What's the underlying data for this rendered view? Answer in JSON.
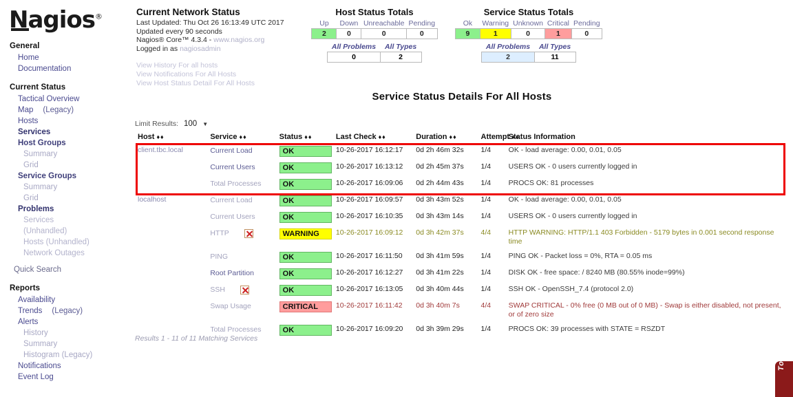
{
  "brand": {
    "name": "Nagios",
    "registered": "®"
  },
  "sidebar": {
    "sections": [
      {
        "title": "General",
        "items": [
          {
            "label": "Home",
            "style": "link"
          },
          {
            "label": "Documentation",
            "style": "link"
          }
        ]
      },
      {
        "title": "Current Status",
        "items": [
          {
            "label": "Tactical Overview",
            "style": "link"
          },
          {
            "label": "Map",
            "suffix": "(Legacy)",
            "style": "link"
          },
          {
            "label": "Hosts",
            "style": "link"
          },
          {
            "label": "Services",
            "style": "bold"
          },
          {
            "label": "Host Groups",
            "style": "semi"
          },
          {
            "label": "Summary",
            "style": "faded"
          },
          {
            "label": "Grid",
            "style": "faded"
          },
          {
            "label": "Service Groups",
            "style": "semi"
          },
          {
            "label": "Summary",
            "style": "faded"
          },
          {
            "label": "Grid",
            "style": "faded"
          },
          {
            "label": "Problems",
            "style": "bold"
          },
          {
            "label": "Services",
            "style": "faded2"
          },
          {
            "label": "(Unhandled)",
            "style": "faded2"
          },
          {
            "label": "Hosts (Unhandled)",
            "style": "faded2"
          },
          {
            "label": "Network Outages",
            "style": "faded2"
          }
        ]
      }
    ],
    "quick_search": "Quick Search",
    "reports": {
      "title": "Reports",
      "items": [
        {
          "label": "Availability",
          "style": "link"
        },
        {
          "label": "Trends",
          "suffix": "(Legacy)",
          "style": "link"
        },
        {
          "label": "Alerts",
          "style": "link"
        },
        {
          "label": "History",
          "style": "faded"
        },
        {
          "label": "Summary",
          "style": "faded"
        },
        {
          "label": "Histogram (Legacy)",
          "style": "faded"
        },
        {
          "label": "Notifications",
          "style": "link"
        },
        {
          "label": "Event Log",
          "style": "link"
        }
      ]
    }
  },
  "network_status": {
    "title": "Current Network Status",
    "last_updated": "Last Updated: Thu Oct 26 16:13:49 UTC 2017",
    "update_interval": "Updated every 90 seconds",
    "version": "Nagios® Core™ 4.3.4 - ",
    "version_url": "www.nagios.org",
    "logged_in_prefix": "Logged in as ",
    "logged_in_user": "nagiosadmin",
    "links": [
      "View History For all hosts",
      "View Notifications For All Hosts",
      "View Host Status Detail For All Hosts"
    ]
  },
  "host_totals": {
    "title": "Host Status Totals",
    "headers": [
      "Up",
      "Down",
      "Unreachable",
      "Pending"
    ],
    "values": [
      "2",
      "0",
      "0",
      "0"
    ],
    "summary_headers": [
      "All Problems",
      "All Types"
    ],
    "summary_values": [
      "0",
      "2"
    ]
  },
  "service_totals": {
    "title": "Service Status Totals",
    "headers": [
      "Ok",
      "Warning",
      "Unknown",
      "Critical",
      "Pending"
    ],
    "values": [
      "9",
      "1",
      "0",
      "1",
      "0"
    ],
    "summary_headers": [
      "All Problems",
      "All Types"
    ],
    "summary_values": [
      "2",
      "11"
    ]
  },
  "main": {
    "title": "Service Status Details For All Hosts",
    "limit_label": "Limit Results:",
    "limit_value": "100",
    "results_footer": "Results 1 - 11 of 11 Matching Services",
    "columns": [
      "Host",
      "Service",
      "Status",
      "Last Check",
      "Duration",
      "Attempt",
      "Status Information"
    ],
    "rows": [
      {
        "host": "client.tbc.local",
        "service": "Current Load",
        "service_muted": false,
        "no_notify": false,
        "status": "OK",
        "status_class": "ok",
        "last_check": "10-26-2017 16:12:17",
        "duration": "0d 2h 46m 32s",
        "attempt": "1/4",
        "info": "OK - load average: 0.00, 0.01, 0.05"
      },
      {
        "host": "",
        "service": "Current Users",
        "service_muted": false,
        "no_notify": false,
        "status": "OK",
        "status_class": "ok",
        "last_check": "10-26-2017 16:13:12",
        "duration": "0d 2h 45m 37s",
        "attempt": "1/4",
        "info": "USERS OK - 0 users currently logged in"
      },
      {
        "host": "",
        "service": "Total Processes",
        "service_muted": true,
        "no_notify": false,
        "status": "OK",
        "status_class": "ok",
        "last_check": "10-26-2017 16:09:06",
        "duration": "0d 2h 44m 43s",
        "attempt": "1/4",
        "info": "PROCS OK: 81 processes"
      },
      {
        "host": "localhost",
        "service": "Current Load",
        "service_muted": true,
        "no_notify": false,
        "status": "OK",
        "status_class": "ok",
        "last_check": "10-26-2017 16:09:57",
        "duration": "0d 3h 43m 52s",
        "attempt": "1/4",
        "info": "OK - load average: 0.00, 0.01, 0.05"
      },
      {
        "host": "",
        "service": "Current Users",
        "service_muted": true,
        "no_notify": false,
        "status": "OK",
        "status_class": "ok",
        "last_check": "10-26-2017 16:10:35",
        "duration": "0d 3h 43m 14s",
        "attempt": "1/4",
        "info": "USERS OK - 0 users currently logged in"
      },
      {
        "host": "",
        "service": "HTTP",
        "service_muted": true,
        "no_notify": true,
        "status": "WARNING",
        "status_class": "warning",
        "last_check": "10-26-2017 16:09:12",
        "duration": "0d 3h 42m 37s",
        "attempt": "4/4",
        "info": "HTTP WARNING: HTTP/1.1 403 Forbidden - 5179 bytes in 0.001 second response time"
      },
      {
        "host": "",
        "service": "PING",
        "service_muted": true,
        "no_notify": false,
        "status": "OK",
        "status_class": "ok",
        "last_check": "10-26-2017 16:11:50",
        "duration": "0d 3h 41m 59s",
        "attempt": "1/4",
        "info": "PING OK - Packet loss = 0%, RTA = 0.05 ms"
      },
      {
        "host": "",
        "service": "Root Partition",
        "service_muted": false,
        "no_notify": false,
        "status": "OK",
        "status_class": "ok",
        "last_check": "10-26-2017 16:12:27",
        "duration": "0d 3h 41m 22s",
        "attempt": "1/4",
        "info": "DISK OK - free space: / 8240 MB (80.55% inode=99%)"
      },
      {
        "host": "",
        "service": "SSH",
        "service_muted": true,
        "no_notify": true,
        "status": "OK",
        "status_class": "ok",
        "last_check": "10-26-2017 16:13:05",
        "duration": "0d 3h 40m 44s",
        "attempt": "1/4",
        "info": "SSH OK - OpenSSH_7.4 (protocol 2.0)"
      },
      {
        "host": "",
        "service": "Swap Usage",
        "service_muted": true,
        "no_notify": false,
        "status": "CRITICAL",
        "status_class": "critical",
        "last_check": "10-26-2017 16:11:42",
        "duration": "0d 3h 40m 7s",
        "attempt": "4/4",
        "info": "SWAP CRITICAL - 0% free (0 MB out of 0 MB) - Swap is either disabled, not present, or of zero size"
      },
      {
        "host": "",
        "service": "Total Processes",
        "service_muted": true,
        "no_notify": false,
        "status": "OK",
        "status_class": "ok",
        "last_check": "10-26-2017 16:09:20",
        "duration": "0d 3h 39m 29s",
        "attempt": "1/4",
        "info": "PROCS OK: 39 processes with STATE = RSZDT"
      }
    ]
  },
  "side_tab": {
    "label": "Tour"
  },
  "colors": {
    "ok": "#8cf08c",
    "warning": "#ffff00",
    "critical": "#ff9d9d",
    "annotation": "#ee0000",
    "link": "#4a4a8f"
  }
}
